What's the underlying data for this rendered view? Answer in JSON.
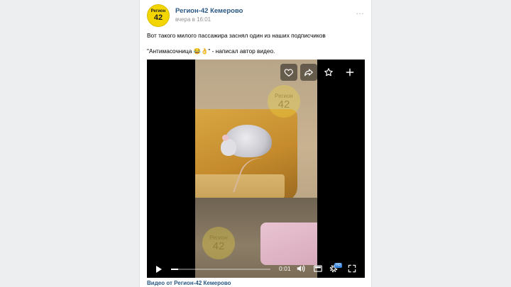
{
  "post": {
    "author": "Регион-42 Кемерово",
    "time": "вчера в 16:01",
    "avatar_line1": "Регион",
    "avatar_line2": "42",
    "text_line1": "Вот такого милого пассажира заснял один из наших подписчиков",
    "text_line2": "\"Антимасочница 😂👌\" - написал автор видео.",
    "more_icon": "…"
  },
  "video": {
    "current_time": "0:01",
    "progress": 0.07,
    "quality_badge": "HD",
    "watermark_line1": "Регион",
    "watermark_line2": "42",
    "caption": "Видео от Регион-42 Кемерово",
    "top_actions": [
      "heart-icon",
      "share-icon",
      "star-icon",
      "plus-icon"
    ],
    "controls": [
      "play-icon",
      "volume-icon",
      "pip-icon",
      "gear-icon",
      "fullscreen-icon"
    ]
  },
  "colors": {
    "link": "#2a5885",
    "background": "#edeef0",
    "accent": "#3f8ae0",
    "avatar": "#f3d600"
  }
}
